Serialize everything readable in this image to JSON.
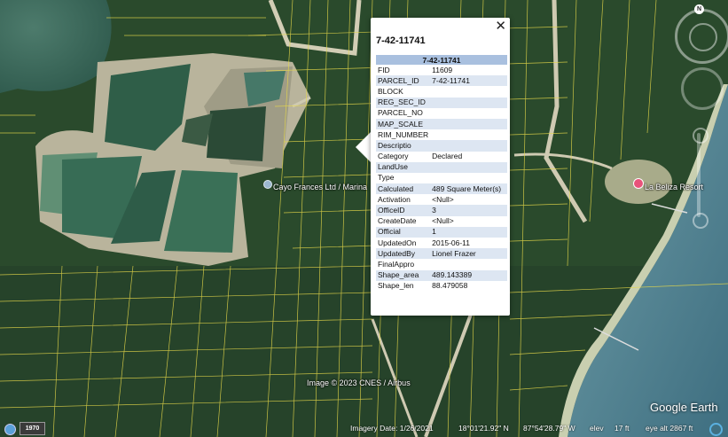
{
  "popup": {
    "title": "7-42-11741",
    "header": "7-42-11741",
    "close_glyph": "✕",
    "rows": [
      {
        "key": "FID",
        "value": "11609"
      },
      {
        "key": "PARCEL_ID",
        "value": "7-42-11741"
      },
      {
        "key": "BLOCK",
        "value": ""
      },
      {
        "key": "REG_SEC_ID",
        "value": ""
      },
      {
        "key": "PARCEL_NO",
        "value": ""
      },
      {
        "key": "MAP_SCALE",
        "value": ""
      },
      {
        "key": "RIM_NUMBER",
        "value": ""
      },
      {
        "key": "Descriptio",
        "value": ""
      },
      {
        "key": "Category",
        "value": "Declared"
      },
      {
        "key": "LandUse",
        "value": ""
      },
      {
        "key": "Type",
        "value": ""
      },
      {
        "key": "Calculated",
        "value": "489 Square Meter(s)"
      },
      {
        "key": "Activation",
        "value": "<Null>"
      },
      {
        "key": "OfficeID",
        "value": "3"
      },
      {
        "key": "CreateDate",
        "value": "<Null>"
      },
      {
        "key": "Official",
        "value": "1"
      },
      {
        "key": "UpdatedOn",
        "value": "2015-06-11"
      },
      {
        "key": "UpdatedBy",
        "value": "Lionel Frazer"
      },
      {
        "key": "FinalAppro",
        "value": ""
      },
      {
        "key": "Shape_area",
        "value": "489.143389"
      },
      {
        "key": "Shape_len",
        "value": "88.479058"
      }
    ]
  },
  "places": {
    "marina": "Cayo Frances Ltd / Marina",
    "resort": "La Beliza Resort"
  },
  "credits": {
    "image": "Image © 2023 CNES / Airbus",
    "logo": "Google Earth"
  },
  "status": {
    "year": "1970",
    "imagery_date": "Imagery Date: 1/26/2021",
    "lat": "18°01'21.92\" N",
    "lon": "87°54'28.79\" W",
    "elev_label": "elev",
    "elev_value": "17 ft",
    "eye_alt": "eye alt 2867 ft"
  },
  "nav": {
    "north": "N"
  }
}
